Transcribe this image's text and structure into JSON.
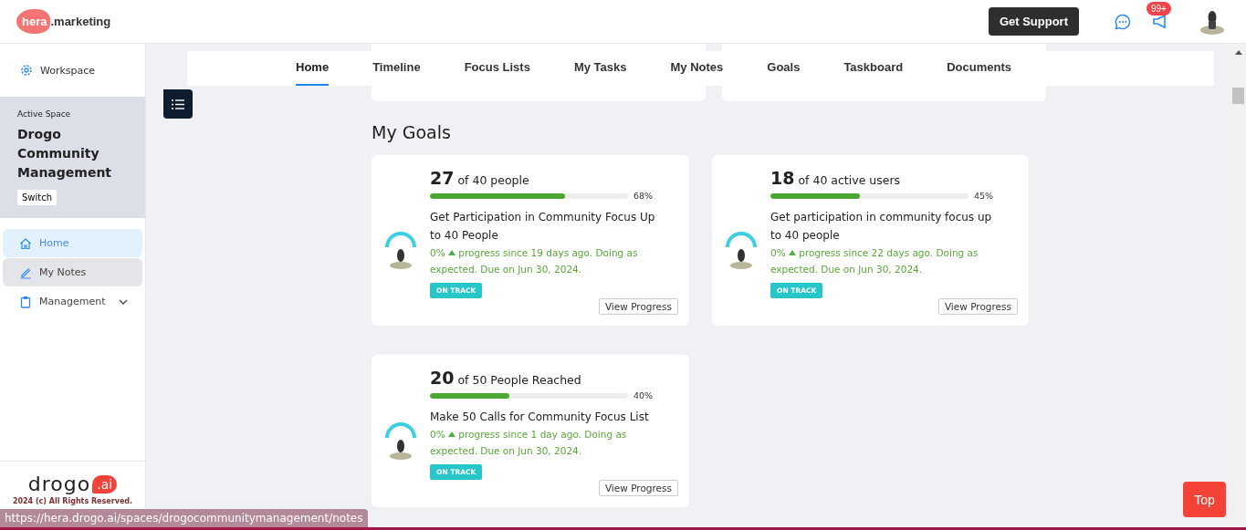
{
  "header": {
    "logo_badge": "hera",
    "logo_text": ".marketing",
    "support_button": "Get Support",
    "notification_count": "99+"
  },
  "sidebar": {
    "workspace": "Workspace",
    "active_space_label": "Active Space",
    "space_name": "Drogo Community Management",
    "switch_button": "Switch",
    "items": [
      {
        "label": "Home",
        "selected": true,
        "hovered": false
      },
      {
        "label": "My Notes",
        "selected": false,
        "hovered": true
      },
      {
        "label": "Management",
        "selected": false,
        "hovered": false,
        "expanded": false
      }
    ],
    "footer_logo": "drogo",
    "footer_logo_badge": ".ai",
    "copyright": "2024 (c) All Rights Reserved."
  },
  "tabs": [
    {
      "label": "Home",
      "selected": true
    },
    {
      "label": "Timeline",
      "selected": false
    },
    {
      "label": "Focus Lists",
      "selected": false
    },
    {
      "label": "My Tasks",
      "selected": false
    },
    {
      "label": "My Notes",
      "selected": false
    },
    {
      "label": "Goals",
      "selected": false
    },
    {
      "label": "Taskboard",
      "selected": false
    },
    {
      "label": "Documents",
      "selected": false
    }
  ],
  "goals_title": "My Goals",
  "goals": [
    {
      "count": "27",
      "target": "of 40 people",
      "level": 0.68,
      "percent": "68%",
      "title": "Get Participation in Community Focus Up to 40 People",
      "change": "0%",
      "note": "progress since 19 days ago. Doing as expected. Due on Jun 30, 2024.",
      "status": {
        "label": "ON TRACK",
        "kind": "on_track"
      },
      "button": "View Progress"
    },
    {
      "count": "18",
      "target": "of 40 active users",
      "level": 0.45,
      "percent": "45%",
      "title": "Get participation in community focus up to 40 people",
      "change": "0%",
      "note": "progress since 22 days ago. Doing as expected. Due on Jun 30, 2024.",
      "status": {
        "label": "ON TRACK",
        "kind": "on_track"
      },
      "button": "View Progress"
    },
    {
      "count": "20",
      "target": "of 50 People Reached",
      "level": 0.4,
      "percent": "40%",
      "title": "Make 50 Calls for Community Focus List",
      "change": "0%",
      "note": "progress since 1 day ago. Doing as expected. Due on Jun 30, 2024.",
      "status": {
        "label": "ON TRACK",
        "kind": "on_track"
      },
      "button": "View Progress"
    }
  ],
  "top_button": "Top",
  "status_url": "https://hera.drogo.ai/spaces/drogocommunitymanagement/notes"
}
